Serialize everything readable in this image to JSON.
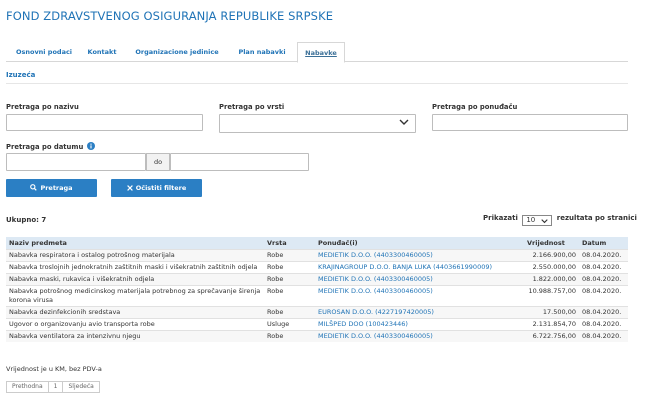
{
  "org_title": "FOND ZDRAVSTVENOG OSIGURANJA REPUBLIKE SRPSKE",
  "tabs": [
    {
      "label": "Osnovni podaci"
    },
    {
      "label": "Kontakt"
    },
    {
      "label": "Organizacione jedinice"
    },
    {
      "label": "Plan nabavki"
    },
    {
      "label": "Nabavke"
    }
  ],
  "section_title": "Izuzeća",
  "filters": {
    "name_label": "Pretraga po nazivu",
    "type_label": "Pretraga po vrsti",
    "supplier_label": "Pretraga po ponuđaču",
    "date_label": "Pretraga po datumu",
    "date_separator": "do"
  },
  "buttons": {
    "search": "Pretraga",
    "clear": "Očistiti filtere"
  },
  "results": {
    "total": "Ukupno: 7",
    "show_label": "Prikazati",
    "per_page": "10",
    "per_page_suffix": "rezultata po stranici"
  },
  "table": {
    "headers": [
      "Naziv predmeta",
      "Vrsta",
      "Ponuđač(i)",
      "Vrijednost",
      "Datum"
    ],
    "rows": [
      {
        "name": "Nabavka respiratora i ostalog potrošnog materijala",
        "type": "Robe",
        "supplier": "MEDIETIK D.O.O. (4403300460005)",
        "value": "2.166.900,00",
        "date": "08.04.2020."
      },
      {
        "name": "Nabavka troslojnih jednokratnih zaštitnih maski i višekratnih zaštitnih odjela",
        "type": "Robe",
        "supplier": "KRAJINAGROUP D.O.O. BANJA LUKA (4403661990009)",
        "value": "2.550.000,00",
        "date": "08.04.2020."
      },
      {
        "name": "Nabavka maski, rukavica i višekratnih odjela",
        "type": "Robe",
        "supplier": "MEDIETIK D.O.O. (4403300460005)",
        "value": "1.822.000,00",
        "date": "08.04.2020."
      },
      {
        "name": "Nabavka potrošnog medicinskog materijala potrebnog za sprečavanje širenja korona virusa",
        "type": "Robe",
        "supplier": "MEDIETIK D.O.O. (4403300460005)",
        "value": "10.988.757,00",
        "date": "08.04.2020."
      },
      {
        "name": "Nabavka dezinfekcionih sredstava",
        "type": "Robe",
        "supplier": "EUROSAN D.O.O. (4227197420005)",
        "value": "17.500,00",
        "date": "08.04.2020."
      },
      {
        "name": "Ugovor o organizovanju avio transporta robe",
        "type": "Usluge",
        "supplier": "MILŠPED DOO (100423446)",
        "value": "2.131.854,70",
        "date": "08.04.2020."
      },
      {
        "name": "Nabavka ventilatora za intenzivnu njegu",
        "type": "Robe",
        "supplier": "MEDIETIK D.O.O. (4403300460005)",
        "value": "6.722.756,00",
        "date": "08.04.2020."
      }
    ]
  },
  "note": "Vrijednost je u KM, bez PDV-a",
  "pager": {
    "prev": "Prethodna",
    "page": "1",
    "next": "Sljedeća"
  },
  "colors": {
    "accent": "#1f73b6",
    "button": "#2b7fc4",
    "header_bg": "#dde9f4"
  },
  "icons": {
    "info": "info-icon",
    "search": "search-icon",
    "clear": "close-icon",
    "select": "chevron-down-icon"
  }
}
